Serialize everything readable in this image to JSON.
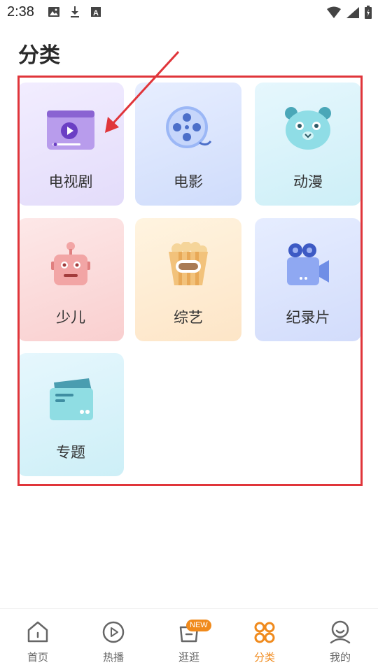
{
  "status_bar": {
    "time": "2:38",
    "left_icons": [
      "image-icon",
      "download-icon",
      "font-icon"
    ],
    "right_icons": [
      "wifi-icon",
      "signal-icon",
      "battery-icon"
    ]
  },
  "page_title": "分类",
  "categories": [
    {
      "label": "电视剧",
      "icon": "tv-icon"
    },
    {
      "label": "电影",
      "icon": "film-reel-icon"
    },
    {
      "label": "动漫",
      "icon": "bear-icon"
    },
    {
      "label": "少儿",
      "icon": "robot-icon"
    },
    {
      "label": "综艺",
      "icon": "popcorn-icon"
    },
    {
      "label": "纪录片",
      "icon": "camera-icon"
    },
    {
      "label": "专题",
      "icon": "card-icon"
    }
  ],
  "bottom_nav": {
    "items": [
      {
        "label": "首页",
        "icon": "home-icon"
      },
      {
        "label": "热播",
        "icon": "play-icon"
      },
      {
        "label": "逛逛",
        "icon": "bag-icon",
        "badge": "NEW"
      },
      {
        "label": "分类",
        "icon": "category-icon"
      },
      {
        "label": "我的",
        "icon": "profile-icon"
      }
    ],
    "active": "分类"
  },
  "colors": {
    "accent": "#f08a1c",
    "highlight": "#e0353a"
  }
}
